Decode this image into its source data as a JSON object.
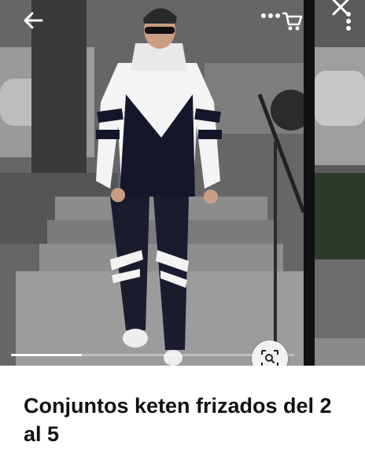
{
  "product": {
    "title": "Conjuntos keten frizados del 2 al 5"
  },
  "gallery": {
    "progress_fraction": 0.25
  },
  "icons": {
    "back": "arrow-left-icon",
    "more": "more-horiz-icon",
    "cart": "cart-icon",
    "close": "close-icon",
    "more_vert": "more-vert-icon",
    "zoom": "zoom-scan-icon"
  },
  "colors": {
    "title": "#111111",
    "icon": "#ffffff"
  }
}
